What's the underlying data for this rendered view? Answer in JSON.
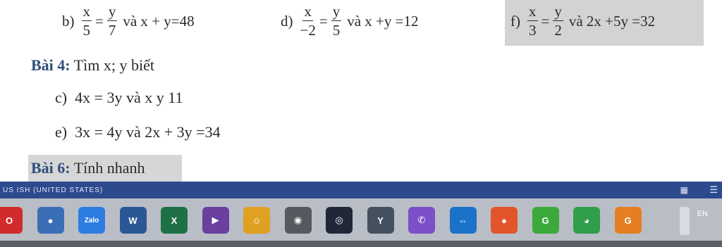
{
  "problems": {
    "b": {
      "label": "b)",
      "a": "x",
      "a_den": "5",
      "b_num": "y",
      "b_den": "7",
      "tail": "và x + y=48"
    },
    "d": {
      "label": "d)",
      "a": "x",
      "a_den": "−2",
      "b_num": "y",
      "b_den": "5",
      "tail": "và x +y =12"
    },
    "f": {
      "label": "f)",
      "a": "x",
      "a_den": "3",
      "b_num": "y",
      "b_den": "2",
      "tail": "và 2x +5y =32"
    }
  },
  "bai4": {
    "heading": "Bài 4:",
    "text": "Tìm x; y biết"
  },
  "items": {
    "c": {
      "label": "c)",
      "text": "4x = 3y và x   y   11"
    },
    "e": {
      "label": "e)",
      "text": "3x = 4y và 2x + 3y =34"
    }
  },
  "bai6": {
    "heading": "Bài 6:",
    "text": "Tính nhanh"
  },
  "statusbar": {
    "text": "US ISH (UNITED STATES)"
  },
  "taskbar": {
    "apps": [
      {
        "name": "opera-icon",
        "color": "#d22b2b",
        "glyph": "O"
      },
      {
        "name": "app-blue-icon",
        "color": "#3a6fb5",
        "glyph": "●"
      },
      {
        "name": "zalo-icon",
        "color": "#2e7de0",
        "glyph": "Zalo"
      },
      {
        "name": "word-icon",
        "color": "#2b5797",
        "glyph": "W"
      },
      {
        "name": "excel-icon",
        "color": "#1e7145",
        "glyph": "X"
      },
      {
        "name": "media-player-icon",
        "color": "#6a3fa0",
        "glyph": "▶"
      },
      {
        "name": "coc-coc-icon",
        "color": "#e0a020",
        "glyph": "☺"
      },
      {
        "name": "camera-icon",
        "color": "#555a60",
        "glyph": "◉"
      },
      {
        "name": "obs-icon",
        "color": "#202838",
        "glyph": "◎"
      },
      {
        "name": "unikey-icon",
        "color": "#44505e",
        "glyph": "Y"
      },
      {
        "name": "viber-icon",
        "color": "#7b4fc7",
        "glyph": "✆"
      },
      {
        "name": "teamviewer-icon",
        "color": "#1a73c9",
        "glyph": "⇔"
      },
      {
        "name": "firefox-icon",
        "color": "#e2542a",
        "glyph": "●"
      },
      {
        "name": "app-green-icon",
        "color": "#3ca93c",
        "glyph": "G"
      },
      {
        "name": "chrome-icon",
        "color": "#2f9f4b",
        "glyph": "◕"
      },
      {
        "name": "geogebra-icon",
        "color": "#e67e22",
        "glyph": "G"
      }
    ],
    "lang": "EN"
  }
}
